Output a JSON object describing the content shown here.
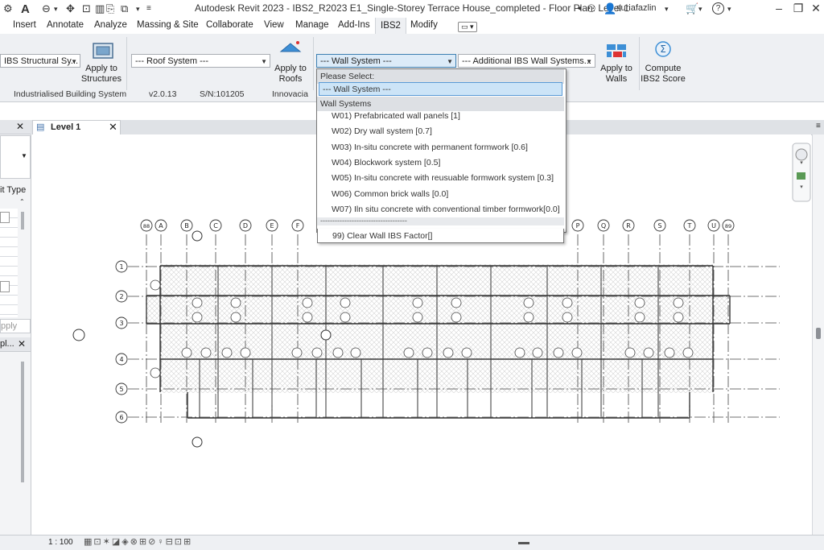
{
  "titlebar": {
    "title": "Autodesk Revit 2023 - IBS2_R2023 E1_Single-Storey Terrace House_completed - Floor Plan: Level 1",
    "user": "suriafazlin",
    "help_icon": "?"
  },
  "tabs": [
    "Insert",
    "Annotate",
    "Analyze",
    "Massing & Site",
    "Collaborate",
    "View",
    "Manage",
    "Add-Ins",
    "IBS2",
    "Modify"
  ],
  "active_tab": "IBS2",
  "ribbon": {
    "structural_combo": "IBS Structural Sy...",
    "apply_structures": [
      "Apply to",
      "Structures"
    ],
    "roof_combo": "--- Roof System ---",
    "apply_roofs": [
      "Apply to",
      "Roofs"
    ],
    "wall_combo": "--- Wall System ---",
    "additional_combo": "--- Additional IBS Wall Systems...",
    "apply_walls": [
      "Apply to",
      "Walls"
    ],
    "compute": [
      "Compute",
      "IBS2 Score"
    ],
    "panel_name": "Industrialised Building System",
    "version": "v2.0.13",
    "serial": "S/N:101205",
    "vendor": "Innovacia"
  },
  "dropdown": {
    "prompt": "Please Select:",
    "selected": "--- Wall System ---",
    "group": "Wall Systems",
    "items": [
      "W01) Prefabricated wall panels [1]",
      "W02) Dry wall system [0.7]",
      "W03) In-situ concrete with permanent formwork [0.6]",
      "W04) Blockwork system [0.5]",
      "W05) In-situ concrete with reusuable formwork system [0.3]",
      "W06) Common brick walls [0.0]",
      "W07) Iln situ concrete with conventional timber formwork[0.0]"
    ],
    "separator": "------------------------------------",
    "clear": "99) Clear Wall IBS Factor[]"
  },
  "properties": {
    "type_label": "it Type",
    "apply": "pply",
    "browser": "pl..."
  },
  "view": {
    "tab_label": "Level 1",
    "scale": "1 : 100"
  },
  "grid": {
    "top_labels": [
      "88",
      "A",
      "B",
      "C",
      "D",
      "E",
      "F",
      "P",
      "Q",
      "R",
      "S",
      "T",
      "U",
      "89"
    ],
    "row_labels": [
      "1",
      "2",
      "3",
      "4",
      "5",
      "6"
    ]
  },
  "colors": {
    "ribbon_bg": "#eef0f3",
    "selection": "#cce4f7",
    "selection_border": "#5a9ad6",
    "hatch": "#d4d4d4"
  }
}
